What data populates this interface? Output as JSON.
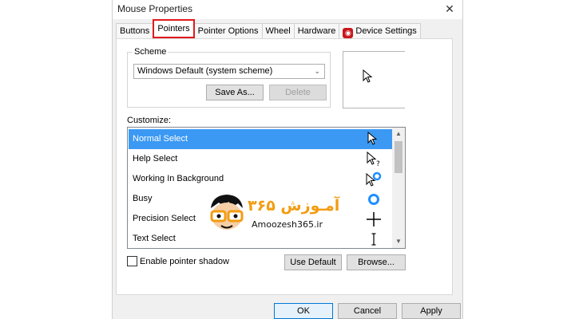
{
  "window": {
    "title": "Mouse Properties",
    "close_glyph": "✕"
  },
  "tabs": [
    {
      "label": "Buttons"
    },
    {
      "label": "Pointers"
    },
    {
      "label": "Pointer Options"
    },
    {
      "label": "Wheel"
    },
    {
      "label": "Hardware"
    },
    {
      "label": "Device Settings",
      "icon": "device-settings-icon"
    }
  ],
  "scheme": {
    "label": "Scheme",
    "selected": "Windows Default (system scheme)",
    "save_as": "Save As...",
    "delete": "Delete"
  },
  "customize": {
    "label": "Customize:",
    "items": [
      {
        "label": "Normal Select",
        "icon": "arrow-cursor-icon"
      },
      {
        "label": "Help Select",
        "icon": "help-cursor-icon"
      },
      {
        "label": "Working In Background",
        "icon": "working-cursor-icon"
      },
      {
        "label": "Busy",
        "icon": "busy-cursor-icon"
      },
      {
        "label": "Precision Select",
        "icon": "crosshair-cursor-icon"
      },
      {
        "label": "Text Select",
        "icon": "text-cursor-icon"
      }
    ],
    "selected_index": 0
  },
  "options": {
    "shadow_label": "Enable pointer shadow",
    "shadow_checked": false,
    "use_default": "Use Default",
    "browse": "Browse..."
  },
  "footer": {
    "ok": "OK",
    "cancel": "Cancel",
    "apply": "Apply"
  },
  "watermark": {
    "site": "Amoozesh365.ir",
    "persian": "آمـوزش ۳۶۵"
  },
  "colors": {
    "selection": "#3b99f3",
    "active_tab_border": "#e0191c",
    "accent": "#0078d7"
  }
}
